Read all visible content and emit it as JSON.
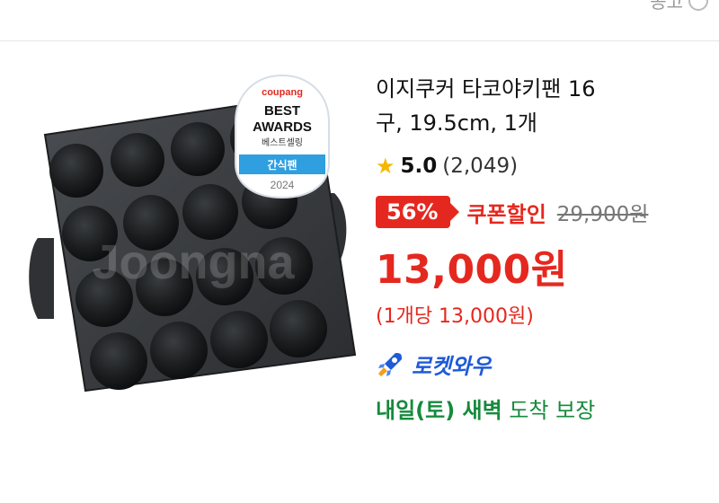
{
  "header": {
    "partial_text": "공고"
  },
  "badge": {
    "brand": "coupang",
    "line1": "BEST",
    "line2": "AWARDS",
    "line3": "베스트셀링",
    "category": "간식팬",
    "year": "2024"
  },
  "watermark": "Joongna",
  "product": {
    "title_line1": "이지쿠커 타코야키팬 16",
    "title_line2": "구, 19.5cm, 1개",
    "rating": {
      "star_icon": "star-icon",
      "score": "5.0",
      "count": "(2,049)"
    },
    "discount_percent": "56%",
    "coupon_label": "쿠폰할인",
    "original_price": "29,900원",
    "sale_price": "13,000원",
    "unit_price": "(1개당 13,000원)",
    "rocket_label": "로켓와우",
    "delivery_bold": "내일(토) 새벽",
    "delivery_rest": " 도착 보장"
  },
  "colors": {
    "accent_red": "#e5281f",
    "rocket_blue": "#1f5bd8",
    "delivery_green": "#168a3c",
    "star": "#f5b700"
  }
}
